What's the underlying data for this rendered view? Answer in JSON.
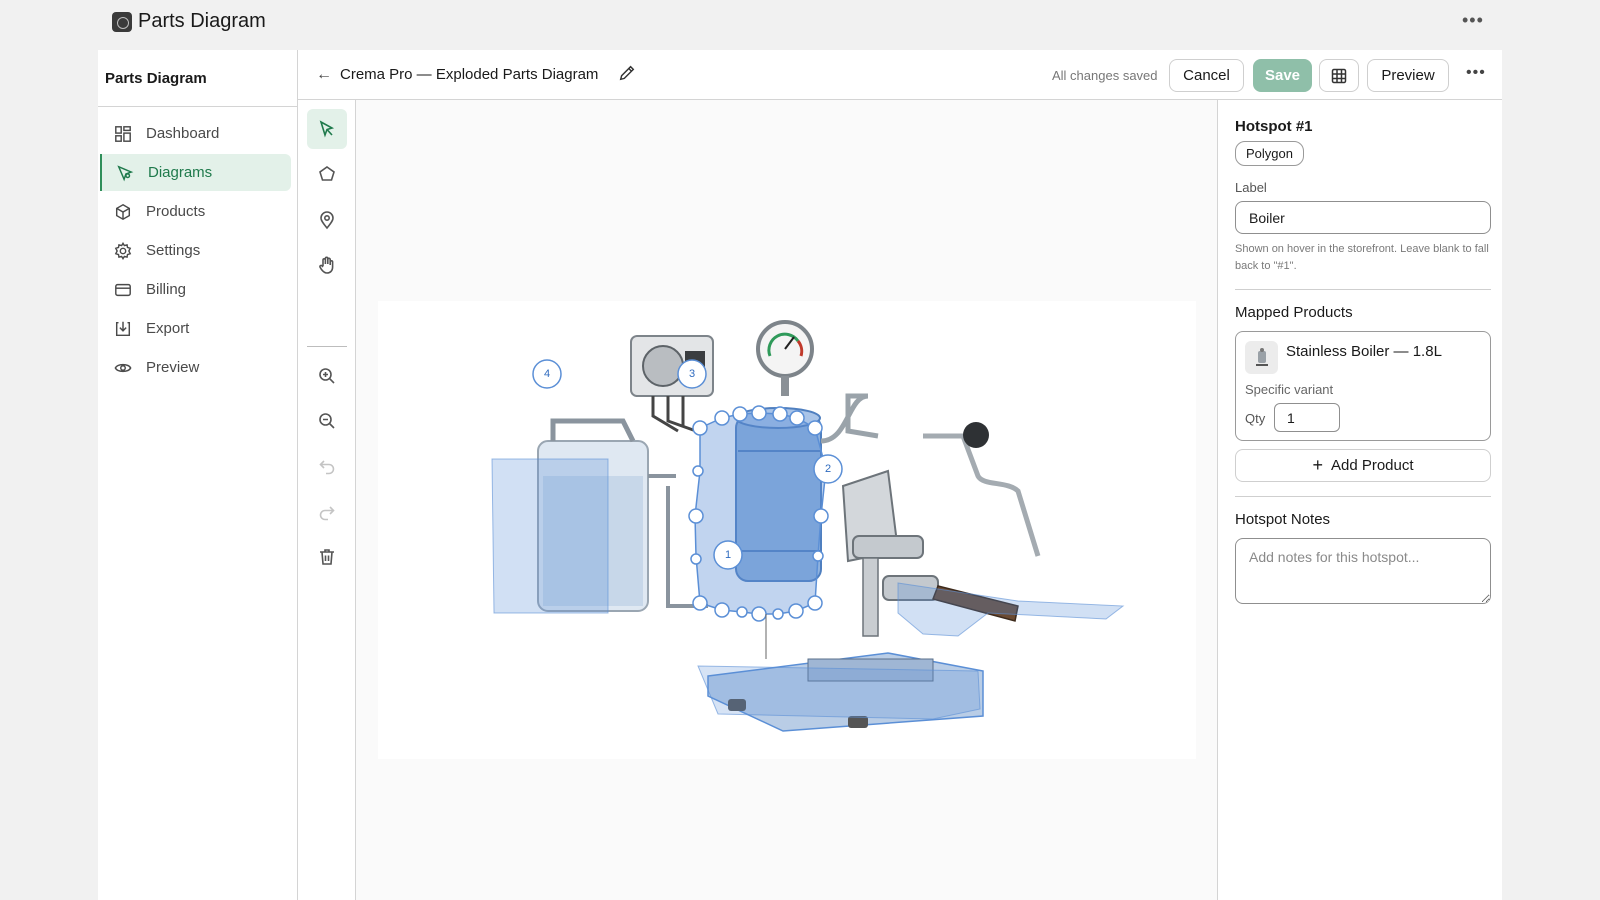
{
  "app": {
    "title": "Parts Diagram"
  },
  "sidebar": {
    "title": "Parts Diagram",
    "items": [
      {
        "label": "Dashboard",
        "icon": "dashboard-icon"
      },
      {
        "label": "Diagrams",
        "icon": "diagram-icon",
        "active": true
      },
      {
        "label": "Products",
        "icon": "box-icon"
      },
      {
        "label": "Settings",
        "icon": "gear-icon"
      },
      {
        "label": "Billing",
        "icon": "card-icon"
      },
      {
        "label": "Export",
        "icon": "download-icon"
      },
      {
        "label": "Preview",
        "icon": "eye-icon"
      }
    ]
  },
  "header": {
    "title": "Crema Pro — Exploded Parts Diagram",
    "status": "All changes saved",
    "cancel_label": "Cancel",
    "save_label": "Save",
    "preview_label": "Preview"
  },
  "toolbar": {
    "tools": [
      "select-tool",
      "polygon-tool",
      "pin-tool",
      "pan-tool",
      "zoom-in-tool",
      "zoom-out-tool",
      "undo-tool",
      "redo-tool",
      "delete-tool"
    ],
    "active": "select-tool"
  },
  "canvas": {
    "hotspots": [
      {
        "number": "1",
        "shape": "polygon",
        "selected": true
      },
      {
        "number": "2"
      },
      {
        "number": "3"
      },
      {
        "number": "4"
      }
    ]
  },
  "inspector": {
    "hotspot_title": "Hotspot #1",
    "shape_type": "Polygon",
    "label_heading": "Label",
    "label_value": "Boiler",
    "label_help": "Shown on hover in the storefront. Leave blank to fall back to \"#1\".",
    "mapped_heading": "Mapped Products",
    "product": {
      "name": "Stainless Boiler — 1.8L",
      "variant": "Specific variant",
      "qty_label": "Qty",
      "qty_value": "1"
    },
    "add_product_label": "Add Product",
    "notes_heading": "Hotspot Notes",
    "notes_placeholder": "Add notes for this hotspot..."
  },
  "colors": {
    "accent": "#1f7a4c",
    "accent_bg": "#e3f1e9",
    "save_disabled": "#8fbfa9",
    "hotspot_fill": "#5b8fd6"
  }
}
